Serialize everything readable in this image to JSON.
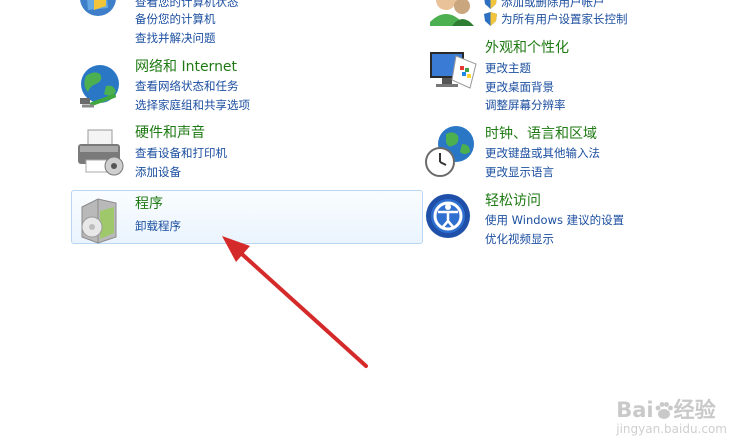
{
  "left_column": [
    {
      "id": "system",
      "title": "",
      "links": [
        "查看您的计算机状态",
        "备份您的计算机",
        "查找并解决问题"
      ]
    },
    {
      "id": "network",
      "title": "网络和 Internet",
      "links": [
        "查看网络状态和任务",
        "选择家庭组和共享选项"
      ]
    },
    {
      "id": "hardware",
      "title": "硬件和声音",
      "links": [
        "查看设备和打印机",
        "添加设备"
      ]
    },
    {
      "id": "programs",
      "title": "程序",
      "links": [
        "卸载程序"
      ]
    }
  ],
  "right_column": [
    {
      "id": "user-accounts",
      "title": "",
      "links": [
        "添加或删除用户帐户",
        "为所有用户设置家长控制"
      ]
    },
    {
      "id": "appearance",
      "title": "外观和个性化",
      "links": [
        "更改主题",
        "更改桌面背景",
        "调整屏幕分辨率"
      ]
    },
    {
      "id": "clock",
      "title": "时钟、语言和区域",
      "links": [
        "更改键盘或其他输入法",
        "更改显示语言"
      ]
    },
    {
      "id": "ease",
      "title": "轻松访问",
      "links": [
        "使用 Windows 建议的设置",
        "优化视频显示"
      ]
    }
  ],
  "watermark": {
    "brand": "Bai",
    "brand_suffix": "经验",
    "url": "jingyan.baidu.com"
  },
  "colors": {
    "title_green": "#1e7a12",
    "link_blue": "#1c4fa0",
    "arrow_red": "#d42a2a",
    "hover_border": "#b8d6f2"
  }
}
